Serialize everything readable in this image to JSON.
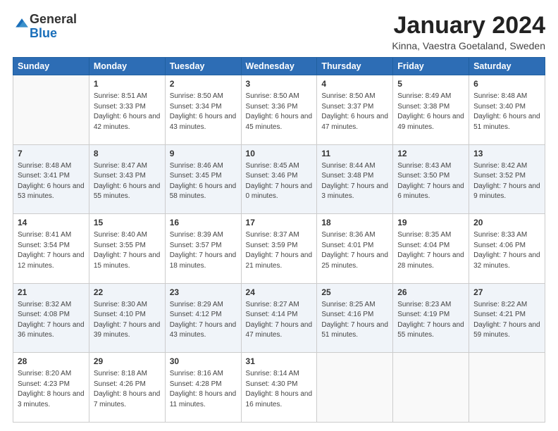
{
  "logo": {
    "general": "General",
    "blue": "Blue"
  },
  "title": "January 2024",
  "location": "Kinna, Vaestra Goetaland, Sweden",
  "days_header": [
    "Sunday",
    "Monday",
    "Tuesday",
    "Wednesday",
    "Thursday",
    "Friday",
    "Saturday"
  ],
  "weeks": [
    [
      {
        "day": "",
        "sunrise": "",
        "sunset": "",
        "daylight": ""
      },
      {
        "day": "1",
        "sunrise": "Sunrise: 8:51 AM",
        "sunset": "Sunset: 3:33 PM",
        "daylight": "Daylight: 6 hours and 42 minutes."
      },
      {
        "day": "2",
        "sunrise": "Sunrise: 8:50 AM",
        "sunset": "Sunset: 3:34 PM",
        "daylight": "Daylight: 6 hours and 43 minutes."
      },
      {
        "day": "3",
        "sunrise": "Sunrise: 8:50 AM",
        "sunset": "Sunset: 3:36 PM",
        "daylight": "Daylight: 6 hours and 45 minutes."
      },
      {
        "day": "4",
        "sunrise": "Sunrise: 8:50 AM",
        "sunset": "Sunset: 3:37 PM",
        "daylight": "Daylight: 6 hours and 47 minutes."
      },
      {
        "day": "5",
        "sunrise": "Sunrise: 8:49 AM",
        "sunset": "Sunset: 3:38 PM",
        "daylight": "Daylight: 6 hours and 49 minutes."
      },
      {
        "day": "6",
        "sunrise": "Sunrise: 8:48 AM",
        "sunset": "Sunset: 3:40 PM",
        "daylight": "Daylight: 6 hours and 51 minutes."
      }
    ],
    [
      {
        "day": "7",
        "sunrise": "Sunrise: 8:48 AM",
        "sunset": "Sunset: 3:41 PM",
        "daylight": "Daylight: 6 hours and 53 minutes."
      },
      {
        "day": "8",
        "sunrise": "Sunrise: 8:47 AM",
        "sunset": "Sunset: 3:43 PM",
        "daylight": "Daylight: 6 hours and 55 minutes."
      },
      {
        "day": "9",
        "sunrise": "Sunrise: 8:46 AM",
        "sunset": "Sunset: 3:45 PM",
        "daylight": "Daylight: 6 hours and 58 minutes."
      },
      {
        "day": "10",
        "sunrise": "Sunrise: 8:45 AM",
        "sunset": "Sunset: 3:46 PM",
        "daylight": "Daylight: 7 hours and 0 minutes."
      },
      {
        "day": "11",
        "sunrise": "Sunrise: 8:44 AM",
        "sunset": "Sunset: 3:48 PM",
        "daylight": "Daylight: 7 hours and 3 minutes."
      },
      {
        "day": "12",
        "sunrise": "Sunrise: 8:43 AM",
        "sunset": "Sunset: 3:50 PM",
        "daylight": "Daylight: 7 hours and 6 minutes."
      },
      {
        "day": "13",
        "sunrise": "Sunrise: 8:42 AM",
        "sunset": "Sunset: 3:52 PM",
        "daylight": "Daylight: 7 hours and 9 minutes."
      }
    ],
    [
      {
        "day": "14",
        "sunrise": "Sunrise: 8:41 AM",
        "sunset": "Sunset: 3:54 PM",
        "daylight": "Daylight: 7 hours and 12 minutes."
      },
      {
        "day": "15",
        "sunrise": "Sunrise: 8:40 AM",
        "sunset": "Sunset: 3:55 PM",
        "daylight": "Daylight: 7 hours and 15 minutes."
      },
      {
        "day": "16",
        "sunrise": "Sunrise: 8:39 AM",
        "sunset": "Sunset: 3:57 PM",
        "daylight": "Daylight: 7 hours and 18 minutes."
      },
      {
        "day": "17",
        "sunrise": "Sunrise: 8:37 AM",
        "sunset": "Sunset: 3:59 PM",
        "daylight": "Daylight: 7 hours and 21 minutes."
      },
      {
        "day": "18",
        "sunrise": "Sunrise: 8:36 AM",
        "sunset": "Sunset: 4:01 PM",
        "daylight": "Daylight: 7 hours and 25 minutes."
      },
      {
        "day": "19",
        "sunrise": "Sunrise: 8:35 AM",
        "sunset": "Sunset: 4:04 PM",
        "daylight": "Daylight: 7 hours and 28 minutes."
      },
      {
        "day": "20",
        "sunrise": "Sunrise: 8:33 AM",
        "sunset": "Sunset: 4:06 PM",
        "daylight": "Daylight: 7 hours and 32 minutes."
      }
    ],
    [
      {
        "day": "21",
        "sunrise": "Sunrise: 8:32 AM",
        "sunset": "Sunset: 4:08 PM",
        "daylight": "Daylight: 7 hours and 36 minutes."
      },
      {
        "day": "22",
        "sunrise": "Sunrise: 8:30 AM",
        "sunset": "Sunset: 4:10 PM",
        "daylight": "Daylight: 7 hours and 39 minutes."
      },
      {
        "day": "23",
        "sunrise": "Sunrise: 8:29 AM",
        "sunset": "Sunset: 4:12 PM",
        "daylight": "Daylight: 7 hours and 43 minutes."
      },
      {
        "day": "24",
        "sunrise": "Sunrise: 8:27 AM",
        "sunset": "Sunset: 4:14 PM",
        "daylight": "Daylight: 7 hours and 47 minutes."
      },
      {
        "day": "25",
        "sunrise": "Sunrise: 8:25 AM",
        "sunset": "Sunset: 4:16 PM",
        "daylight": "Daylight: 7 hours and 51 minutes."
      },
      {
        "day": "26",
        "sunrise": "Sunrise: 8:23 AM",
        "sunset": "Sunset: 4:19 PM",
        "daylight": "Daylight: 7 hours and 55 minutes."
      },
      {
        "day": "27",
        "sunrise": "Sunrise: 8:22 AM",
        "sunset": "Sunset: 4:21 PM",
        "daylight": "Daylight: 7 hours and 59 minutes."
      }
    ],
    [
      {
        "day": "28",
        "sunrise": "Sunrise: 8:20 AM",
        "sunset": "Sunset: 4:23 PM",
        "daylight": "Daylight: 8 hours and 3 minutes."
      },
      {
        "day": "29",
        "sunrise": "Sunrise: 8:18 AM",
        "sunset": "Sunset: 4:26 PM",
        "daylight": "Daylight: 8 hours and 7 minutes."
      },
      {
        "day": "30",
        "sunrise": "Sunrise: 8:16 AM",
        "sunset": "Sunset: 4:28 PM",
        "daylight": "Daylight: 8 hours and 11 minutes."
      },
      {
        "day": "31",
        "sunrise": "Sunrise: 8:14 AM",
        "sunset": "Sunset: 4:30 PM",
        "daylight": "Daylight: 8 hours and 16 minutes."
      },
      {
        "day": "",
        "sunrise": "",
        "sunset": "",
        "daylight": ""
      },
      {
        "day": "",
        "sunrise": "",
        "sunset": "",
        "daylight": ""
      },
      {
        "day": "",
        "sunrise": "",
        "sunset": "",
        "daylight": ""
      }
    ]
  ]
}
